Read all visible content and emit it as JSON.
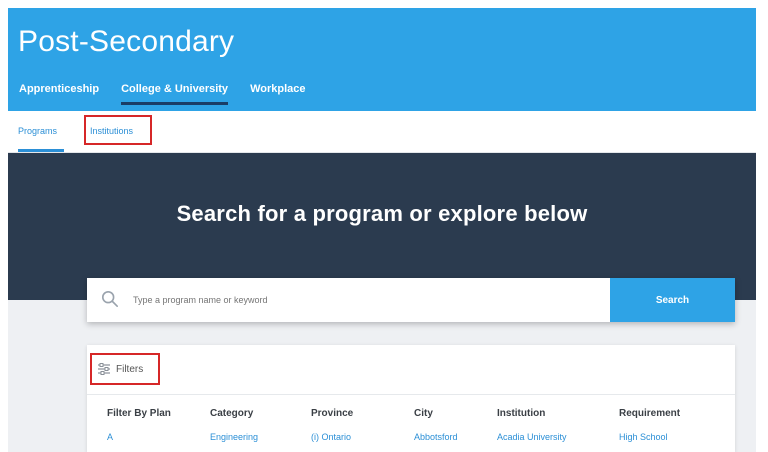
{
  "header": {
    "title": "Post-Secondary",
    "nav": [
      {
        "label": "Apprenticeship",
        "active": false
      },
      {
        "label": "College & University",
        "active": true
      },
      {
        "label": "Workplace",
        "active": false
      }
    ]
  },
  "sub_tabs": [
    {
      "label": "Programs",
      "active": true
    },
    {
      "label": "Institutions",
      "active": false
    }
  ],
  "banner": {
    "heading": "Search for a program or explore below"
  },
  "search": {
    "placeholder": "Type a program name or keyword",
    "button_label": "Search",
    "icon": "search-icon"
  },
  "filters": {
    "label": "Filters",
    "icon": "filters-icon",
    "columns": [
      {
        "heading": "Filter By Plan",
        "first_item": "A"
      },
      {
        "heading": "Category",
        "first_item": "Engineering"
      },
      {
        "heading": "Province",
        "first_item": "(i) Ontario"
      },
      {
        "heading": "City",
        "first_item": "Abbotsford"
      },
      {
        "heading": "Institution",
        "first_item": "Acadia University"
      },
      {
        "heading": "Requirement",
        "first_item": "High School"
      }
    ]
  },
  "colors": {
    "header_blue": "#2ea3e6",
    "banner_dark": "#2b3b4f",
    "link_blue": "#2b8fd6",
    "highlight_red": "#d62728"
  }
}
